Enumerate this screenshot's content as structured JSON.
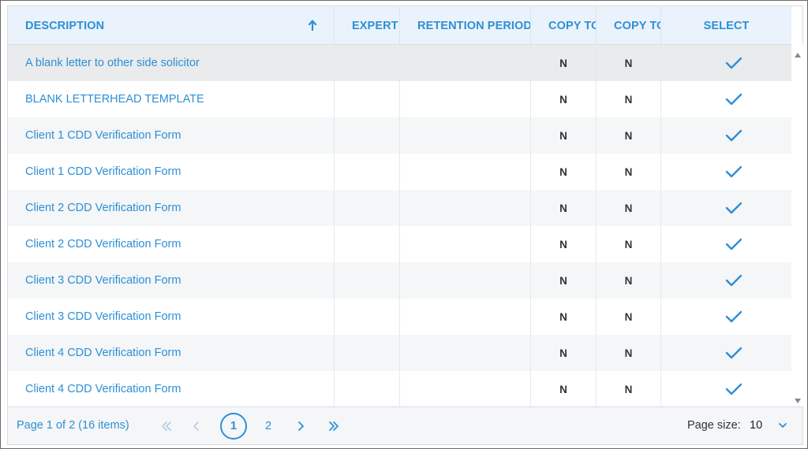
{
  "grid": {
    "columns": {
      "description": "DESCRIPTION",
      "expert": "EXPERT",
      "retention": "RETENTION PERIOD",
      "copy_to_1": "COPY TO",
      "copy_to_2": "COPY TO",
      "select": "SELECT"
    },
    "rows": [
      {
        "description": "A blank letter to other side solicitor",
        "copy1": "N",
        "copy2": "N"
      },
      {
        "description": "BLANK LETTERHEAD TEMPLATE",
        "copy1": "N",
        "copy2": "N"
      },
      {
        "description": "Client 1 CDD Verification Form",
        "copy1": "N",
        "copy2": "N"
      },
      {
        "description": "Client 1 CDD Verification Form",
        "copy1": "N",
        "copy2": "N"
      },
      {
        "description": "Client 2 CDD Verification Form",
        "copy1": "N",
        "copy2": "N"
      },
      {
        "description": "Client 2 CDD Verification Form",
        "copy1": "N",
        "copy2": "N"
      },
      {
        "description": "Client 3 CDD Verification Form",
        "copy1": "N",
        "copy2": "N"
      },
      {
        "description": "Client 3 CDD Verification Form",
        "copy1": "N",
        "copy2": "N"
      },
      {
        "description": "Client 4 CDD Verification Form",
        "copy1": "N",
        "copy2": "N"
      },
      {
        "description": "Client 4 CDD Verification Form",
        "copy1": "N",
        "copy2": "N"
      }
    ]
  },
  "pager": {
    "info": "Page 1 of 2 (16 items)",
    "page_1": "1",
    "page_2": "2",
    "page_size_label": "Page size:",
    "page_size_value": "10"
  },
  "colors": {
    "accent": "#2d8fd5",
    "header_bg": "#eaf3fc",
    "row_alt": "#f4f6f7"
  },
  "icons": {
    "sort": "arrow-up-icon",
    "select": "check-icon",
    "first": "double-chevron-left-icon",
    "prev": "chevron-left-icon",
    "next": "chevron-right-icon",
    "last": "double-chevron-right-icon",
    "dropdown": "chevron-down-icon"
  }
}
